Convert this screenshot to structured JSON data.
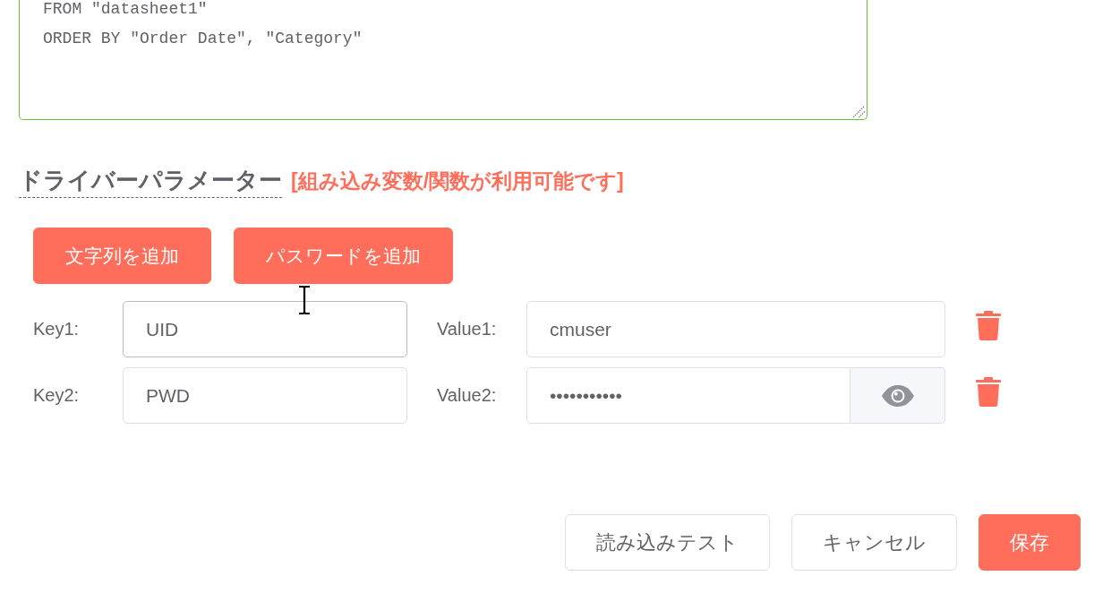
{
  "query_editor": {
    "valid": true,
    "lines": [
      "FROM \"datasheet1\"",
      "ORDER BY \"Order Date\", \"Category\""
    ]
  },
  "driver_parameters": {
    "title": "ドライバーパラメーター",
    "note": "[組み込み変数/関数が利用可能です]",
    "add_buttons": [
      "文字列を追加",
      "パスワードを追加"
    ],
    "rows": [
      {
        "kind": "text",
        "key_label": "Key1:",
        "key": "UID",
        "key_hovered": true,
        "value_label": "Value1:",
        "value": "cmuser"
      },
      {
        "kind": "password",
        "key_label": "Key2:",
        "key": "PWD",
        "key_hovered": false,
        "value_label": "Value2:",
        "value": "•••••••••••"
      }
    ]
  },
  "footer_buttons": [
    {
      "label": "読み込みテスト",
      "kind": "secondary"
    },
    {
      "label": "キャンセル",
      "kind": "secondary"
    },
    {
      "label": "保存",
      "kind": "primary"
    }
  ]
}
